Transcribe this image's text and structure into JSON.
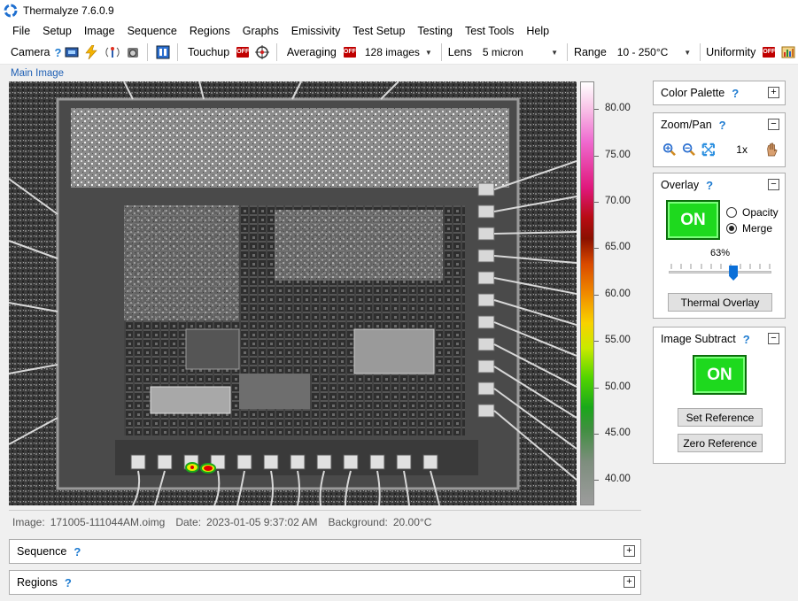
{
  "window": {
    "title": "Thermalyze 7.6.0.9"
  },
  "menu": [
    "File",
    "Setup",
    "Image",
    "Sequence",
    "Regions",
    "Graphs",
    "Emissivity",
    "Test Setup",
    "Testing",
    "Test Tools",
    "Help"
  ],
  "toolbar": {
    "camera_label": "Camera",
    "touchup_label": "Touchup",
    "touchup_state": "OFF",
    "averaging_label": "Averaging",
    "averaging_state": "OFF",
    "averaging_value": "128 images",
    "lens_label": "Lens",
    "lens_value": "5 micron",
    "range_label": "Range",
    "range_value": "10 - 250°C",
    "uniformity_label": "Uniformity",
    "uniformity_state": "OFF",
    "help_glyph": "?"
  },
  "main_image": {
    "label": "Main Image"
  },
  "colorbar": {
    "ticks": [
      "80.00",
      "75.00",
      "70.00",
      "65.00",
      "60.00",
      "55.00",
      "50.00",
      "45.00",
      "40.00"
    ]
  },
  "info": {
    "image_key": "Image:",
    "image_val": "171005-111044AM.oimg",
    "date_key": "Date:",
    "date_val": "2023-01-05 9:37:02 AM",
    "bg_key": "Background:",
    "bg_val": "20.00°C"
  },
  "panels": {
    "color_palette": {
      "title": "Color Palette",
      "toggle": "+"
    },
    "zoom_pan": {
      "title": "Zoom/Pan",
      "toggle": "−",
      "zoom_level": "1x"
    },
    "overlay": {
      "title": "Overlay",
      "toggle": "−",
      "on_label": "ON",
      "opacity_label": "Opacity",
      "merge_label": "Merge",
      "selected_mode": "Merge",
      "slider_value": "63%",
      "slider_fraction": 0.63,
      "thermal_overlay_btn": "Thermal Overlay"
    },
    "image_subtract": {
      "title": "Image Subtract",
      "toggle": "−",
      "on_label": "ON",
      "set_ref_btn": "Set Reference",
      "zero_ref_btn": "Zero Reference"
    },
    "sequence": {
      "title": "Sequence",
      "toggle": "+"
    },
    "regions": {
      "title": "Regions",
      "toggle": "+"
    }
  },
  "colors": {
    "accent": "#1e7bd0",
    "on_green": "#1ed91e",
    "off_red": "#c00000"
  }
}
